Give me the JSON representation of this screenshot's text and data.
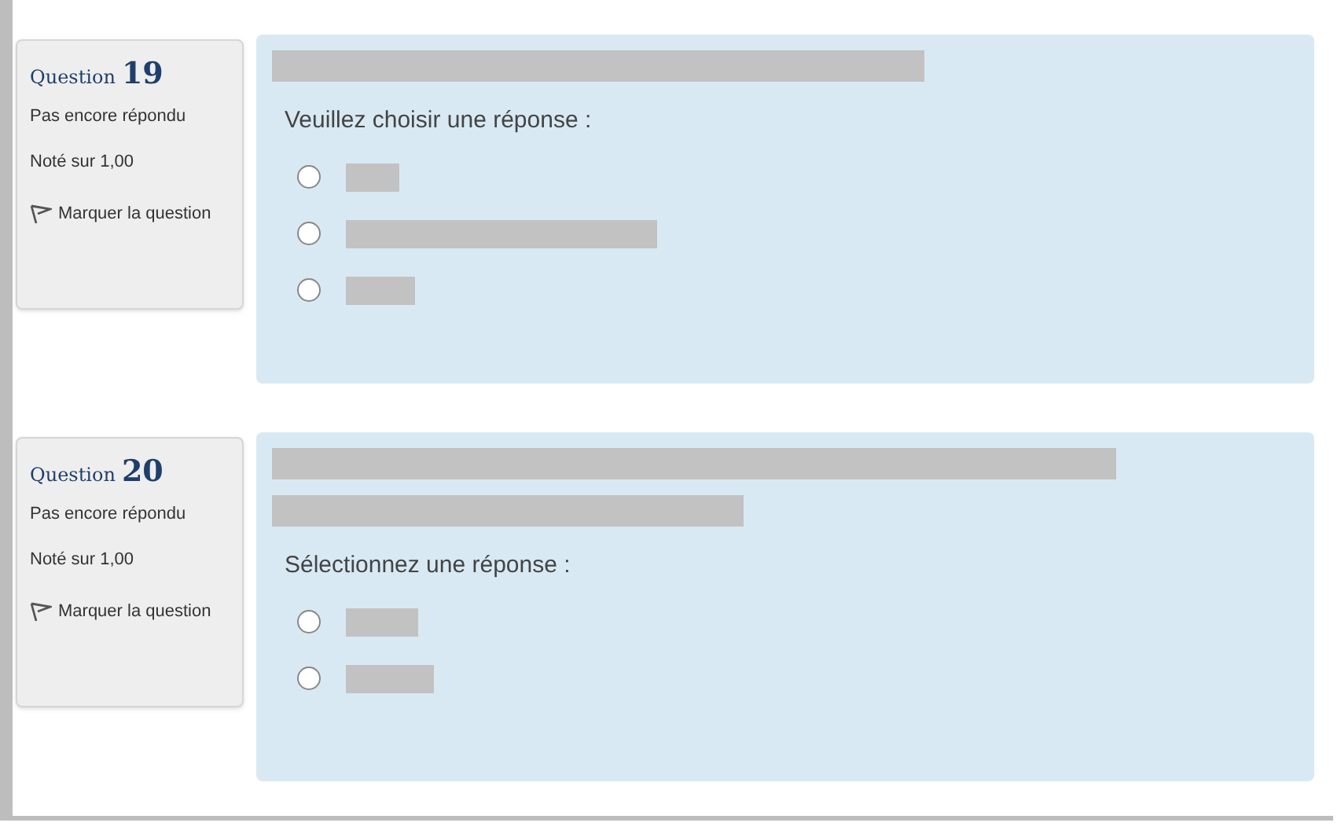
{
  "questions": [
    {
      "label": "Question",
      "number": "19",
      "status": "Pas encore répondu",
      "grade": "Noté sur 1,00",
      "flag": "Marquer la question",
      "prompt": "Veuillez choisir une réponse :",
      "options": [
        {
          "selected": false
        },
        {
          "selected": false
        },
        {
          "selected": false
        }
      ]
    },
    {
      "label": "Question",
      "number": "20",
      "status": "Pas encore répondu",
      "grade": "Noté sur 1,00",
      "flag": "Marquer la question",
      "prompt": "Sélectionnez une réponse :",
      "options": [
        {
          "selected": false
        },
        {
          "selected": false
        }
      ]
    }
  ]
}
